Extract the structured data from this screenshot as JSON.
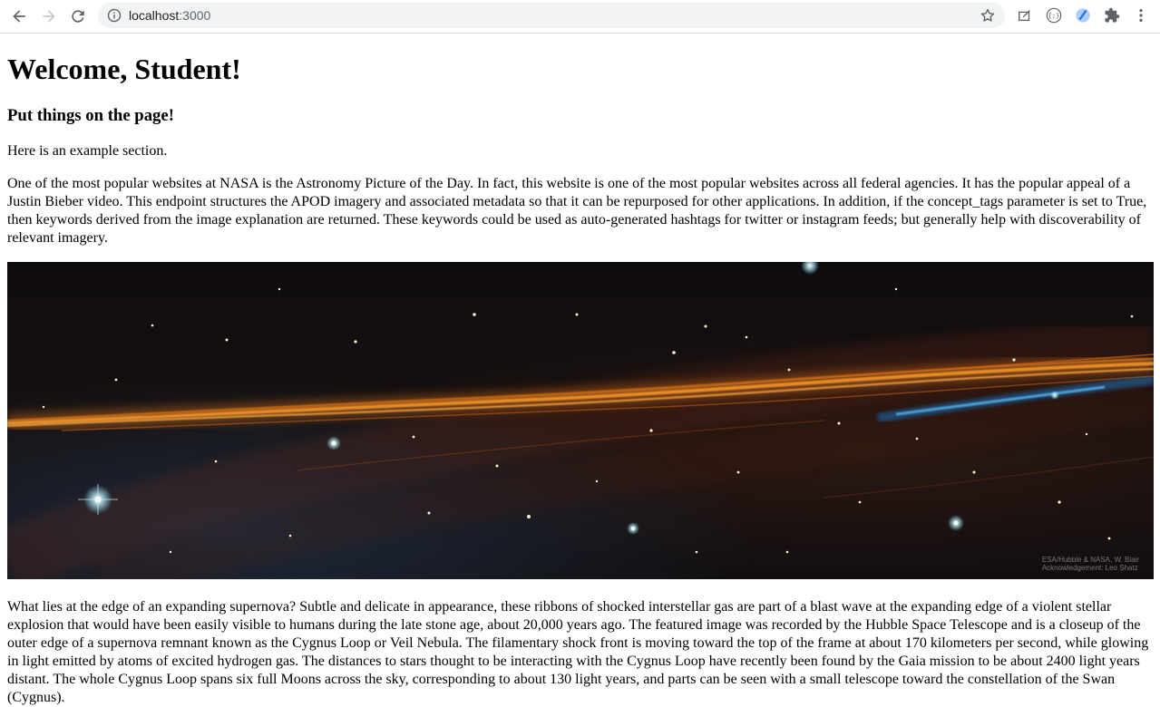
{
  "browser": {
    "url_host": "localhost",
    "url_port": ":3000"
  },
  "page": {
    "title": "Welcome, Student!",
    "subtitle": "Put things on the page!",
    "intro": "Here is an example section.",
    "description": "One of the most popular websites at NASA is the Astronomy Picture of the Day. In fact, this website is one of the most popular websites across all federal agencies. It has the popular appeal of a Justin Bieber video. This endpoint structures the APOD imagery and associated metadata so that it can be repurposed for other applications. In addition, if the concept_tags parameter is set to True, then keywords derived from the image explanation are returned. These keywords could be used as auto-generated hashtags for twitter or instagram feeds; but generally help with discoverability of relevant imagery.",
    "image_credit_line1": "ESA/Hubble & NASA, W. Blair",
    "image_credit_line2": "Acknowledgement: Leo Shatz",
    "explanation": "What lies at the edge of an expanding supernova? Subtle and delicate in appearance, these ribbons of shocked interstellar gas are part of a blast wave at the expanding edge of a violent stellar explosion that would have been easily visible to humans during the late stone age, about 20,000 years ago. The featured image was recorded by the Hubble Space Telescope and is a closeup of the outer edge of a supernova remnant known as the Cygnus Loop or Veil Nebula. The filamentary shock front is moving toward the top of the frame at about 170 kilometers per second, while glowing in light emitted by atoms of excited hydrogen gas. The distances to stars thought to be interacting with the Cygnus Loop have recently been found by the Gaia mission to be about 2400 light years distant. The whole Cygnus Loop spans six full Moons across the sky, corresponding to about 130 light years, and parts can be seen with a small telescope toward the constellation of the Swan (Cygnus)."
  }
}
